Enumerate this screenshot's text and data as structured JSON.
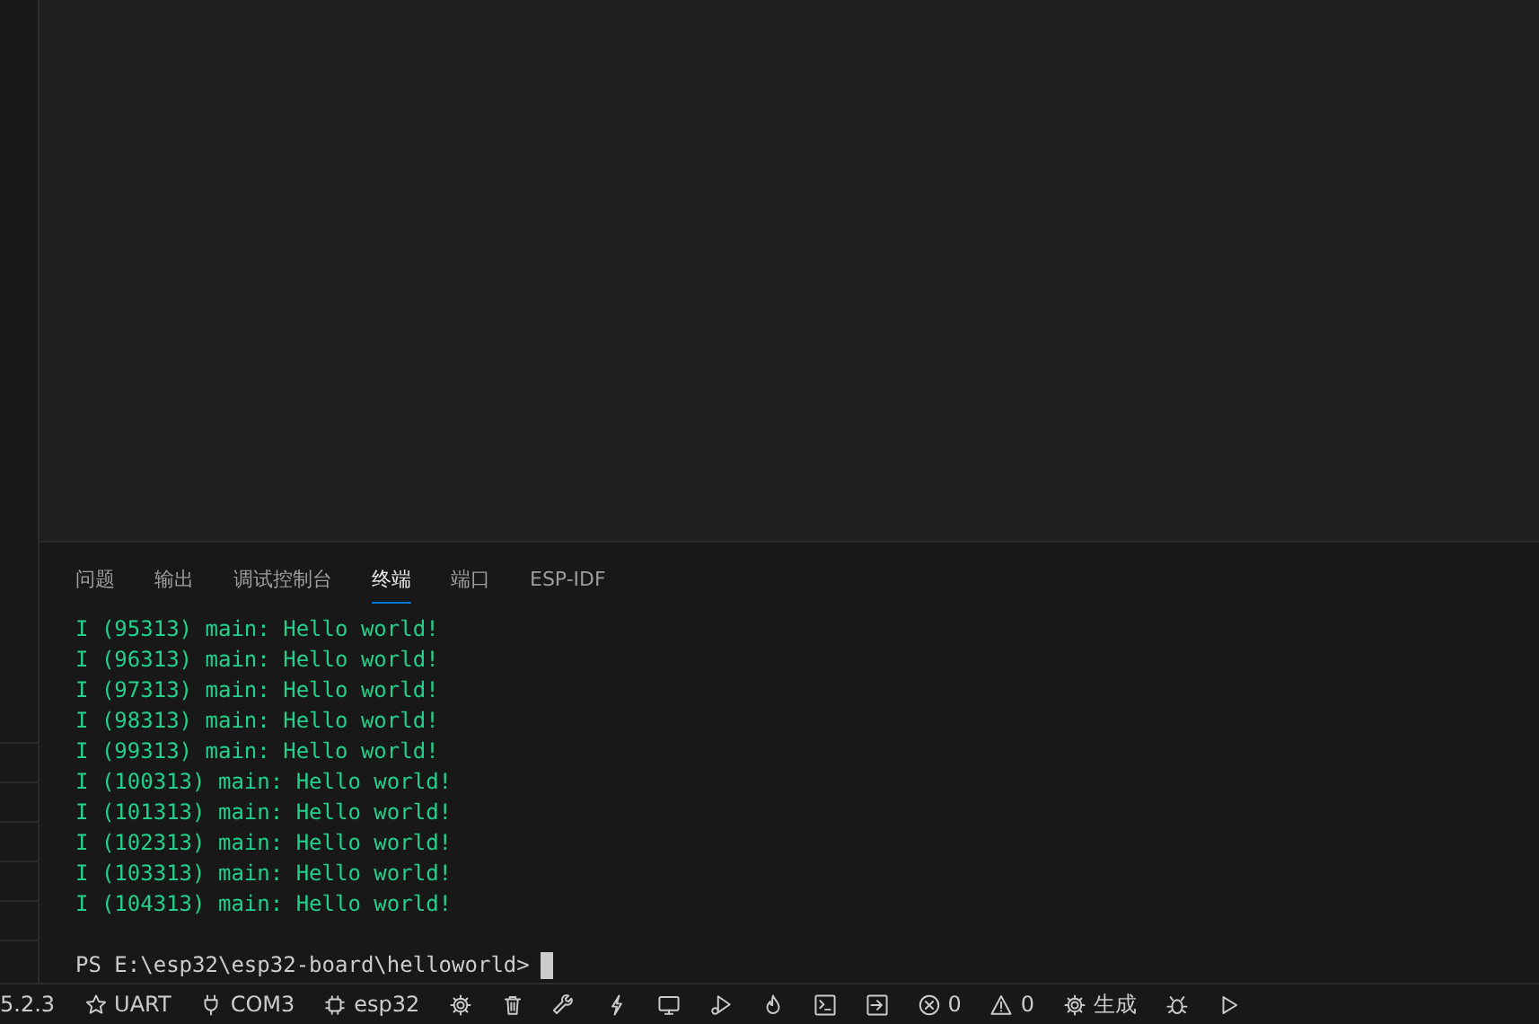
{
  "panel": {
    "tabs": [
      {
        "label": "问题",
        "selected": false
      },
      {
        "label": "输出",
        "selected": false
      },
      {
        "label": "调试控制台",
        "selected": false
      },
      {
        "label": "终端",
        "selected": true
      },
      {
        "label": "端口",
        "selected": false
      },
      {
        "label": "ESP-IDF",
        "selected": false
      }
    ],
    "terminal": {
      "lines": [
        "I (95313) main: Hello world!",
        "I (96313) main: Hello world!",
        "I (97313) main: Hello world!",
        "I (98313) main: Hello world!",
        "I (99313) main: Hello world!",
        "I (100313) main: Hello world!",
        "I (101313) main: Hello world!",
        "I (102313) main: Hello world!",
        "I (103313) main: Hello world!",
        "I (104313) main: Hello world!"
      ],
      "prompt": "PS E:\\esp32\\esp32-board\\helloworld>"
    }
  },
  "status_bar": {
    "items": [
      {
        "kind": "text",
        "label": "5.2.3"
      },
      {
        "kind": "star",
        "label": "UART"
      },
      {
        "kind": "plug",
        "label": "COM3"
      },
      {
        "kind": "chip",
        "label": "esp32"
      },
      {
        "kind": "gear"
      },
      {
        "kind": "trash"
      },
      {
        "kind": "wrench"
      },
      {
        "kind": "bolt"
      },
      {
        "kind": "monitor"
      },
      {
        "kind": "flask"
      },
      {
        "kind": "flame"
      },
      {
        "kind": "terminal"
      },
      {
        "kind": "arrow"
      },
      {
        "kind": "error",
        "label": "0"
      },
      {
        "kind": "warning",
        "label": "0"
      },
      {
        "kind": "gear",
        "label": "生成"
      },
      {
        "kind": "bug"
      },
      {
        "kind": "play"
      }
    ]
  }
}
